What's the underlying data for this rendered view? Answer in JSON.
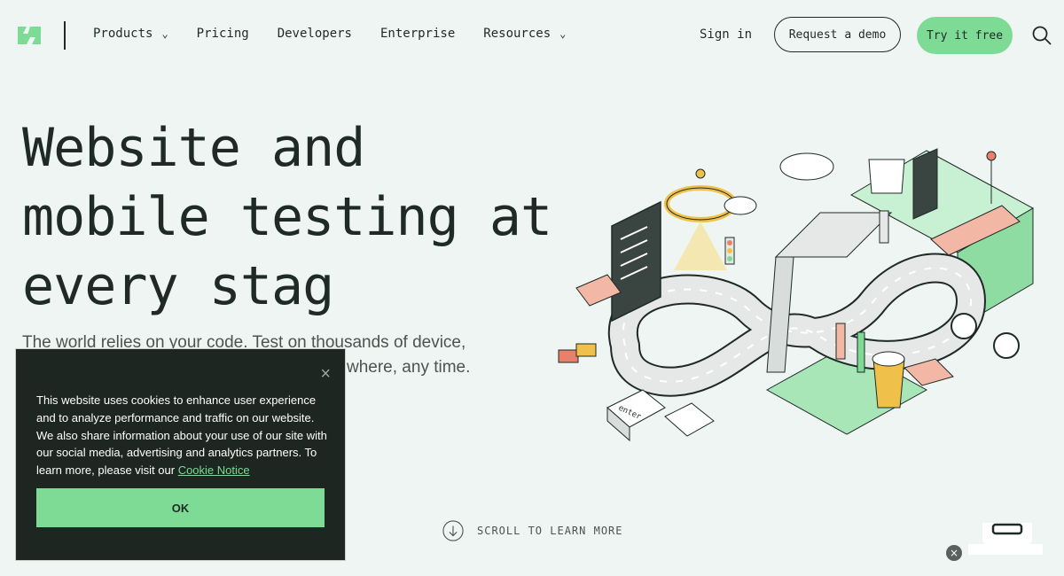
{
  "header": {
    "nav": [
      {
        "label": "Products",
        "has_dropdown": true
      },
      {
        "label": "Pricing",
        "has_dropdown": false
      },
      {
        "label": "Developers",
        "has_dropdown": false
      },
      {
        "label": "Enterprise",
        "has_dropdown": false
      },
      {
        "label": "Resources",
        "has_dropdown": true
      }
    ],
    "signin_label": "Sign in",
    "demo_label": "Request a demo",
    "try_label": "Try it free",
    "icons": {
      "logo": "brand-logo-icon",
      "search": "search-icon",
      "dropdown": "chevron-double-down-icon"
    }
  },
  "hero": {
    "title_line1": "Website and",
    "title_line2": "mobile testing at",
    "title_line3": "every stag",
    "subtitle_line1": "The world relies on your code. Test on thousands of device,",
    "subtitle_line2": "where, any time.",
    "illustration_caption": "enter"
  },
  "scroll": {
    "label": "SCROLL TO LEARN MORE"
  },
  "cookie": {
    "text": "This website uses cookies to enhance user experience and to analyze performance and traffic on our website. We also share information about your use of our site with our social media, advertising and analytics partners. To learn more, please visit our ",
    "link_label": "Cookie Notice",
    "ok_label": "OK",
    "close_symbol": "×"
  },
  "widget": {
    "close_symbol": "×"
  },
  "colors": {
    "accent": "#7ddb95",
    "background": "#eef5f2",
    "dark": "#1d2621",
    "text": "#1f2a26"
  }
}
